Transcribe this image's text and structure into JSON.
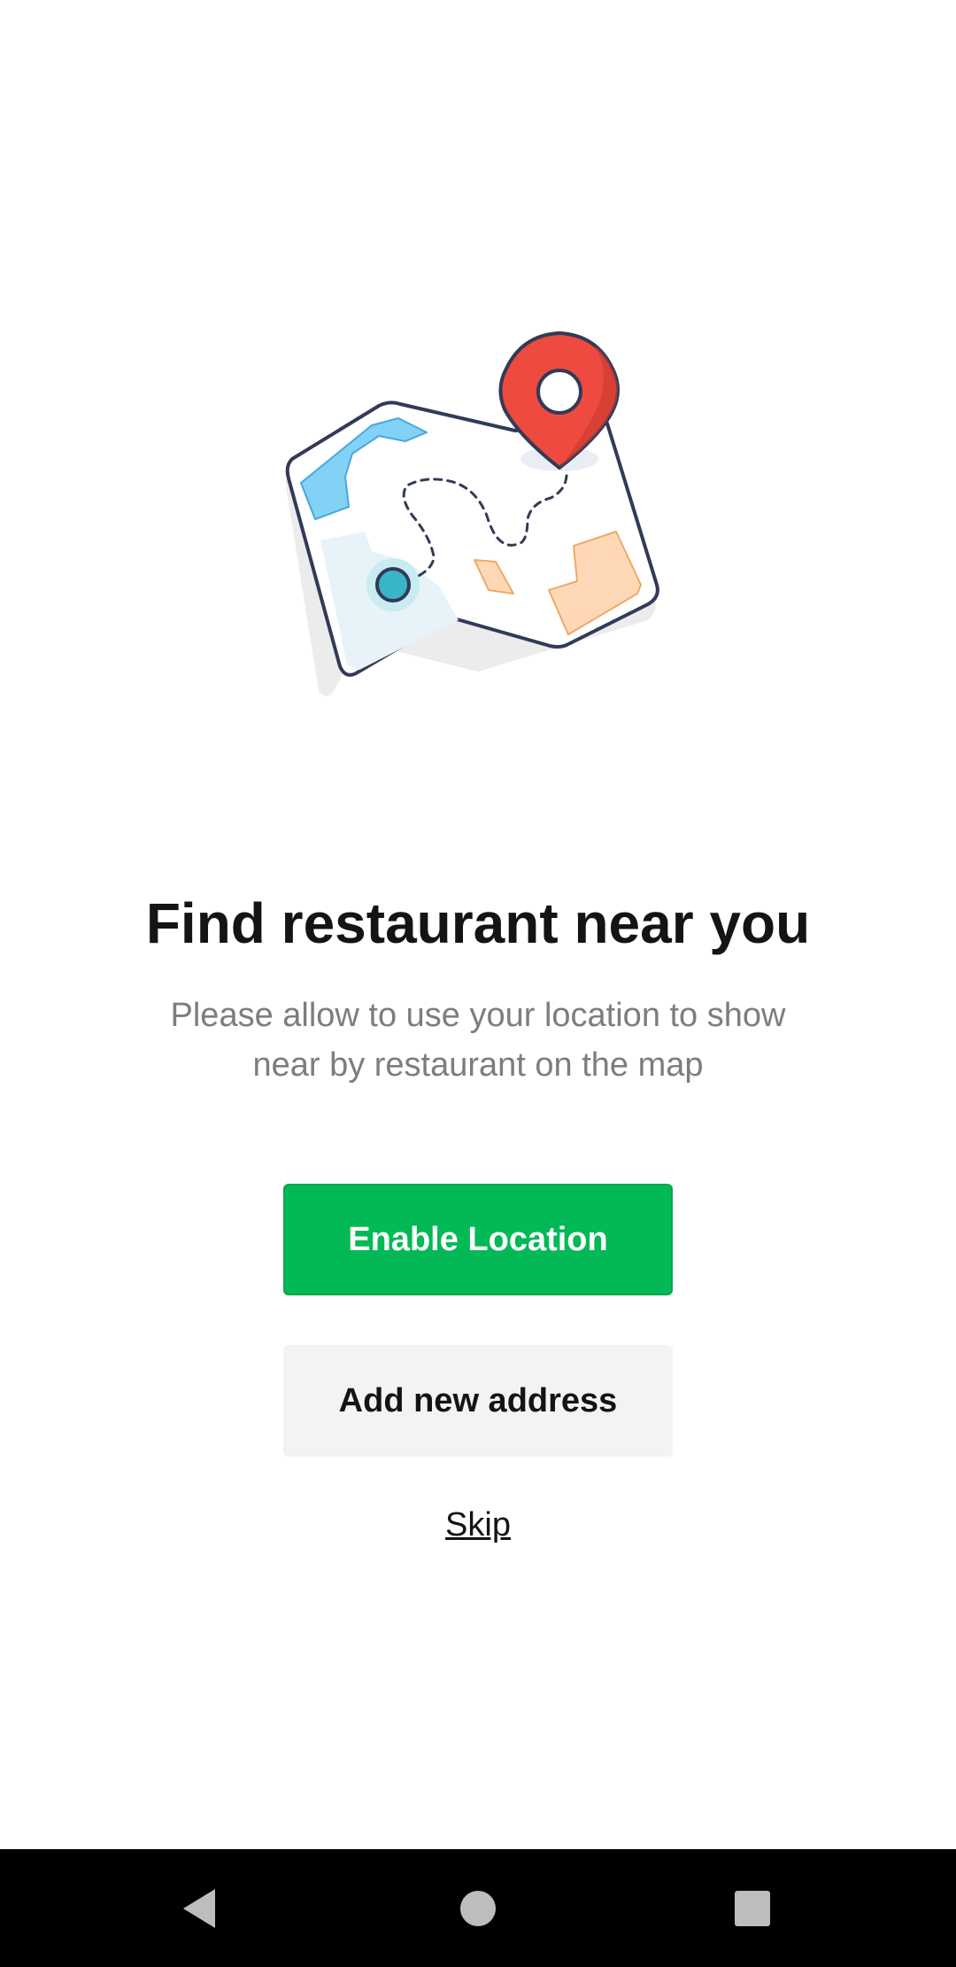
{
  "onboarding": {
    "title": "Find restaurant near you",
    "subtitle_line1": "Please allow to use your location to show",
    "subtitle_line2": "near by restaurant on the map",
    "enable_button_label": "Enable Location",
    "add_address_button_label": "Add new address",
    "skip_label": "Skip",
    "illustration_icon": "map-with-location-pin-icon"
  },
  "navbar": {
    "back_icon": "back-triangle-icon",
    "home_icon": "home-circle-icon",
    "recents_icon": "recents-square-icon"
  },
  "colors": {
    "primary_green": "#02b956",
    "pin_red": "#ee4a3f",
    "title_text": "#141414",
    "subtitle_text": "#7d7d7d",
    "secondary_button_bg": "#f3f3f3",
    "navbar_bg": "#000000"
  }
}
